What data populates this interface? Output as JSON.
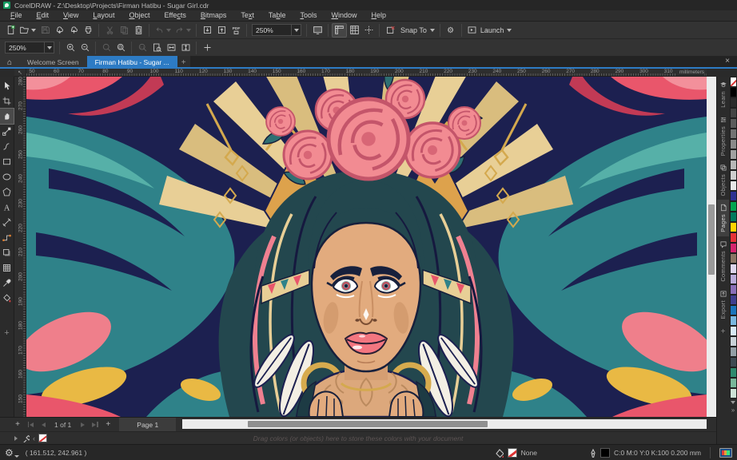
{
  "titlebar": {
    "title": "CorelDRAW - Z:\\Desktop\\Projects\\Firman Hatibu -  Sugar Girl.cdr"
  },
  "menubar": {
    "items": [
      {
        "label": "File",
        "accel": 0
      },
      {
        "label": "Edit",
        "accel": 0
      },
      {
        "label": "View",
        "accel": 0
      },
      {
        "label": "Layout",
        "accel": 0
      },
      {
        "label": "Object",
        "accel": 0
      },
      {
        "label": "Effects",
        "accel": 4
      },
      {
        "label": "Bitmaps",
        "accel": 0
      },
      {
        "label": "Text",
        "accel": 2
      },
      {
        "label": "Table",
        "accel": 2
      },
      {
        "label": "Tools",
        "accel": 0
      },
      {
        "label": "Window",
        "accel": 0
      },
      {
        "label": "Help",
        "accel": 0
      }
    ]
  },
  "toolbar": {
    "groups": [
      [
        {
          "icon": "new-document"
        },
        {
          "icon": "open-document",
          "dd": true
        },
        {
          "icon": "save-document",
          "off": true
        },
        {
          "icon": "cloud-download"
        },
        {
          "icon": "cloud-upload"
        },
        {
          "icon": "print"
        }
      ],
      [
        {
          "icon": "cut",
          "off": true
        },
        {
          "icon": "copy",
          "off": true
        },
        {
          "icon": "paste"
        }
      ],
      [
        {
          "icon": "undo",
          "off": true,
          "dd": true
        },
        {
          "icon": "redo",
          "off": true,
          "dd": true
        }
      ],
      [
        {
          "icon": "import"
        },
        {
          "icon": "export"
        },
        {
          "icon": "publish-pdf"
        }
      ],
      [
        {
          "combo": "250%",
          "name": "zoom-levels-combo"
        }
      ],
      [
        {
          "icon": "full-screen-preview"
        }
      ],
      [
        {
          "icon": "show-rulers",
          "on": true
        },
        {
          "icon": "show-grid"
        },
        {
          "icon": "show-guidelines"
        }
      ],
      [
        {
          "icon": "snap-off"
        },
        {
          "label": "Snap To",
          "dd": true,
          "name": "snap-to-menu"
        }
      ],
      [
        {
          "icon": "options-gear"
        }
      ],
      [
        {
          "icon": "launch-app",
          "label": "Launch",
          "dd": true,
          "name": "launch-menu"
        }
      ]
    ]
  },
  "propbar": {
    "groups": [
      [
        {
          "combo": "250%",
          "name": "zoom-level-combo"
        }
      ],
      [
        {
          "icon": "zoom-in"
        },
        {
          "icon": "zoom-out"
        }
      ],
      [
        {
          "icon": "zoom-selected",
          "off": true
        },
        {
          "icon": "zoom-all"
        }
      ],
      [
        {
          "icon": "zoom-actual",
          "off": true
        },
        {
          "icon": "zoom-page"
        },
        {
          "icon": "zoom-width"
        },
        {
          "icon": "zoom-height"
        }
      ],
      [
        {
          "icon": "add-plus"
        }
      ]
    ]
  },
  "tabs": {
    "home_icon": "⌂",
    "welcome": "Welcome Screen",
    "active": "Firman Hatibu -  Sugar ...",
    "new_tab": "+",
    "close": "×"
  },
  "ruler": {
    "units": "millimeters",
    "origin_icon": "↖",
    "h_labels": [
      50,
      60,
      70,
      80,
      90,
      100,
      110,
      120,
      130,
      140,
      150,
      160,
      170,
      180,
      190,
      200,
      210,
      220,
      230,
      240,
      250,
      260,
      270,
      280,
      290,
      300,
      310
    ],
    "v_labels": [
      280,
      270,
      260,
      250,
      240,
      230,
      220,
      210,
      200,
      190,
      180,
      170,
      160,
      150
    ]
  },
  "toolbox": {
    "tools": [
      {
        "icon": "pick-tool"
      },
      {
        "icon": "crop-tool"
      },
      {
        "icon": "pan-tool",
        "selected": true
      },
      {
        "icon": "shape-tool"
      },
      {
        "icon": "curve-tool"
      },
      {
        "icon": "rectangle-tool"
      },
      {
        "icon": "ellipse-tool"
      },
      {
        "icon": "polygon-tool"
      },
      {
        "icon": "text-tool"
      },
      {
        "icon": "dimension-tool"
      },
      {
        "icon": "connector-tool"
      },
      {
        "icon": "drop-shadow-tool"
      },
      {
        "icon": "mesh-fill-tool"
      },
      {
        "icon": "eyedropper-tool"
      },
      {
        "icon": "interactive-fill-tool"
      }
    ],
    "more_label": "+"
  },
  "dockers": {
    "tabs": [
      {
        "label": "Learn",
        "icon": "learn"
      },
      {
        "label": "Properties",
        "icon": "properties"
      },
      {
        "label": "Objects",
        "icon": "objects"
      },
      {
        "label": "Pages",
        "icon": "pages",
        "active": true
      },
      {
        "label": "Comments",
        "icon": "comments"
      },
      {
        "label": "Export",
        "icon": "export-docker"
      }
    ],
    "add_label": "+"
  },
  "palette": {
    "expand_label": "»",
    "colors": [
      "none",
      "#000000",
      "#2b2b2b",
      "#454545",
      "#5c5c5c",
      "#737373",
      "#8a8a8a",
      "#a1a1a1",
      "#b8b8b8",
      "#cfcfcf",
      "#e8e8e8",
      "#2e3192",
      "#00a651",
      "#007a5e",
      "#ffd400",
      "#e53238",
      "#d6246e",
      "#8a7565",
      "#ddd6ec",
      "#b9abd9",
      "#8a6fb8",
      "#3f3f8f",
      "#1b75bc",
      "#7ab8e0",
      "#d8e9f5",
      "#c9d2d8",
      "#939fa6",
      "#3e4a52",
      "#2f8a6e",
      "#79b79a",
      "#cfe3d8"
    ]
  },
  "pagebar": {
    "add_page": "+",
    "indicator": "1 of 1",
    "page_tab": "Page 1"
  },
  "docpalette": {
    "hint": "Drag colors (or objects) here to store these colors with your document",
    "collapse": "‹"
  },
  "statusbar": {
    "coords": "( 161.512, 242.961 )",
    "fill_label": "None",
    "outline_label": "C:0 M:0 Y:0 K:100  0.200 mm"
  }
}
